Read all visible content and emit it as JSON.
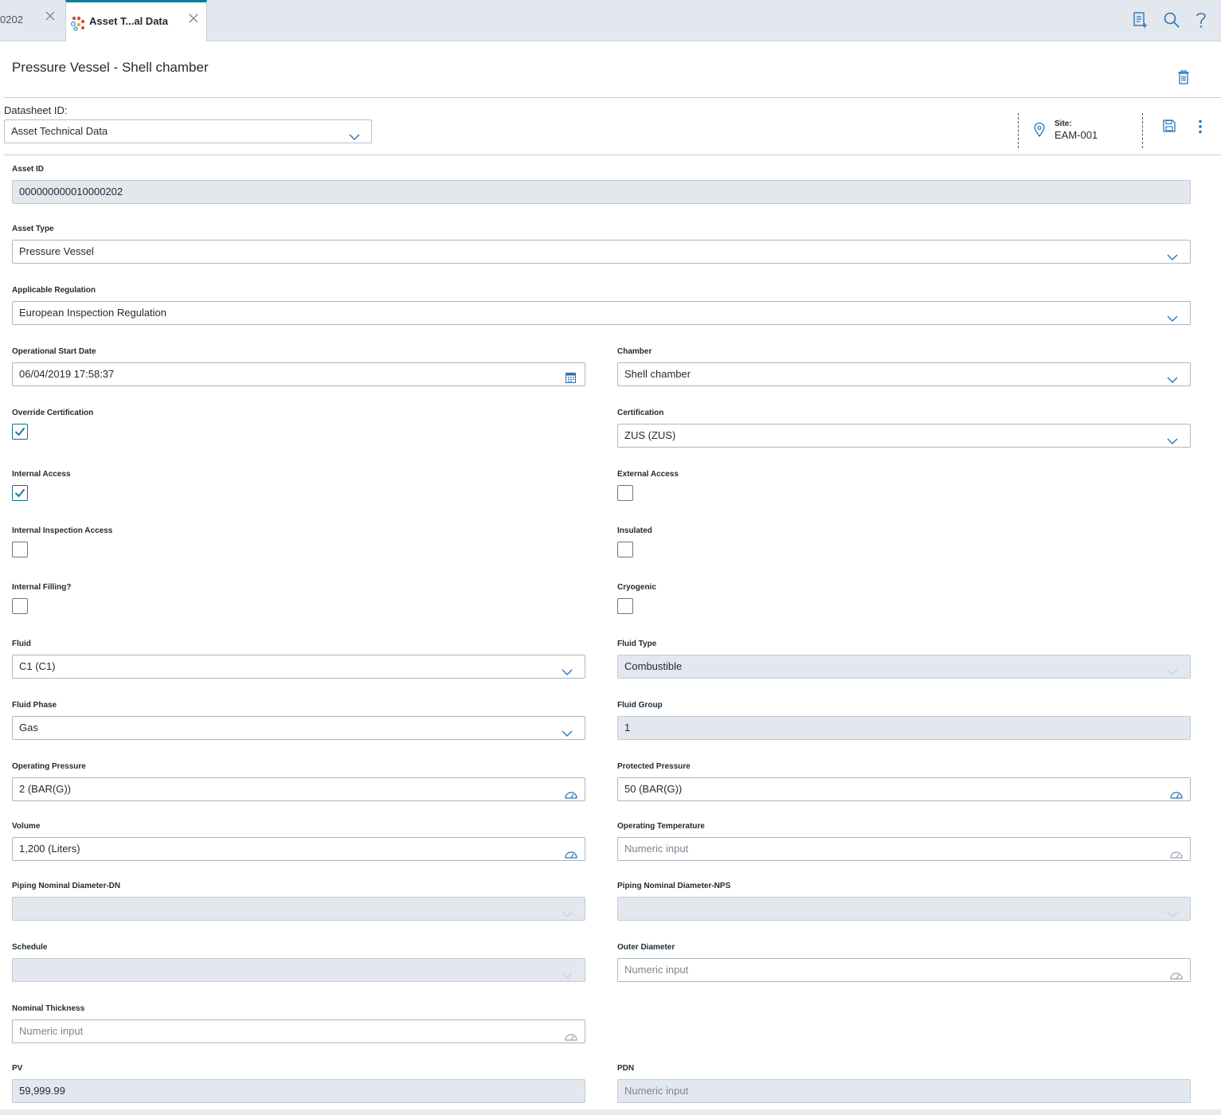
{
  "tabs": [
    {
      "label": "0202",
      "active": false
    },
    {
      "label": "Asset T...al Data",
      "active": true
    }
  ],
  "toolbar_icons": [
    "add-note-icon",
    "search-icon",
    "help-icon"
  ],
  "page": {
    "title": "Pressure Vessel - Shell chamber"
  },
  "datasheet": {
    "label": "Datasheet ID:",
    "value": "Asset Technical Data"
  },
  "site": {
    "label": "Site:",
    "value": "EAM-001"
  },
  "colors": {
    "accent": "#0f7c96",
    "icon_blue": "#2b73b6",
    "readonly_bg": "#e3e8ee"
  },
  "fields": {
    "asset_id": {
      "label": "Asset ID",
      "value": "000000000010000202"
    },
    "asset_type": {
      "label": "Asset Type",
      "value": "Pressure Vessel"
    },
    "applicable_regulation": {
      "label": "Applicable Regulation",
      "value": "European Inspection Regulation"
    },
    "operational_start_date": {
      "label": "Operational Start Date",
      "value": "06/04/2019 17:58:37"
    },
    "chamber": {
      "label": "Chamber",
      "value": "Shell chamber"
    },
    "override_certification": {
      "label": "Override Certification",
      "checked": true
    },
    "certification": {
      "label": "Certification",
      "value": "ZUS (ZUS)"
    },
    "internal_access": {
      "label": "Internal Access",
      "checked": true
    },
    "external_access": {
      "label": "External Access",
      "checked": false
    },
    "internal_inspection_access": {
      "label": "Internal Inspection Access",
      "checked": false
    },
    "insulated": {
      "label": "Insulated",
      "checked": false
    },
    "internal_filling": {
      "label": "Internal Filling?",
      "checked": false
    },
    "cryogenic": {
      "label": "Cryogenic",
      "checked": false
    },
    "fluid": {
      "label": "Fluid",
      "value": "C1 (C1)"
    },
    "fluid_type": {
      "label": "Fluid Type",
      "value": "Combustible"
    },
    "fluid_phase": {
      "label": "Fluid Phase",
      "value": "Gas"
    },
    "fluid_group": {
      "label": "Fluid Group",
      "value": "1"
    },
    "operating_pressure": {
      "label": "Operating Pressure",
      "value": "2 (BAR(G))"
    },
    "protected_pressure": {
      "label": "Protected Pressure",
      "value": "50 (BAR(G))"
    },
    "volume": {
      "label": "Volume",
      "value": "1,200 (Liters)"
    },
    "operating_temperature": {
      "label": "Operating Temperature",
      "placeholder": "Numeric input"
    },
    "piping_dn": {
      "label": "Piping Nominal Diameter-DN",
      "value": ""
    },
    "piping_nps": {
      "label": "Piping Nominal Diameter-NPS",
      "value": ""
    },
    "schedule": {
      "label": "Schedule",
      "value": ""
    },
    "outer_diameter": {
      "label": "Outer Diameter",
      "placeholder": "Numeric input"
    },
    "nominal_thickness": {
      "label": "Nominal Thickness",
      "placeholder": "Numeric input"
    },
    "pv": {
      "label": "PV",
      "value": "59,999.99"
    },
    "pdn": {
      "label": "PDN",
      "placeholder": "Numeric input"
    }
  }
}
